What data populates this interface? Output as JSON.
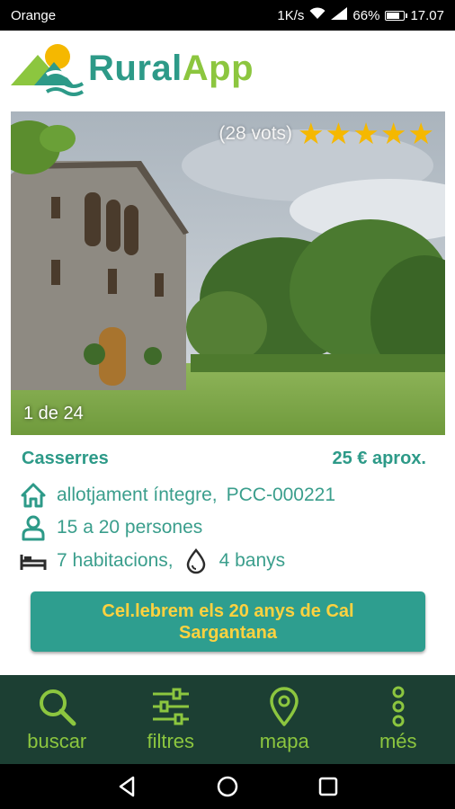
{
  "status_bar": {
    "carrier": "Orange",
    "speed": "1K/s",
    "battery": "66%",
    "battery_level": 0.66,
    "time": "17.07"
  },
  "header": {
    "logo_text_rural": "Rural",
    "logo_text_app": "App"
  },
  "listing": {
    "votes": "(28 vots)",
    "rating_stars": 5,
    "photo_counter": "1 de 24",
    "location": "Casserres",
    "price": "25 € aprox.",
    "accommodation": "allotjament íntegre,",
    "license": "PCC-000221",
    "capacity": "15 a 20 persones",
    "rooms": "7 habitacions,",
    "bathrooms": "4 banys",
    "promo": "Cel.lebrem els 20 anys de Cal Sargantana"
  },
  "nav": {
    "search": "buscar",
    "filters": "filtres",
    "map": "mapa",
    "more": "més"
  },
  "colors": {
    "brand_teal": "#2d9a88",
    "brand_green": "#8cc63f",
    "nav_bg": "#1c3f33",
    "promo_bg": "#2e9e8f",
    "promo_text": "#ffd23f",
    "star": "#f5b800"
  },
  "icons": {
    "accommodation": "house-icon",
    "capacity": "person-icon",
    "rooms": "bed-icon",
    "bathrooms": "water-drop-icon",
    "search": "search-icon",
    "filters": "sliders-icon",
    "map": "map-pin-icon",
    "more": "more-vertical-icon"
  }
}
